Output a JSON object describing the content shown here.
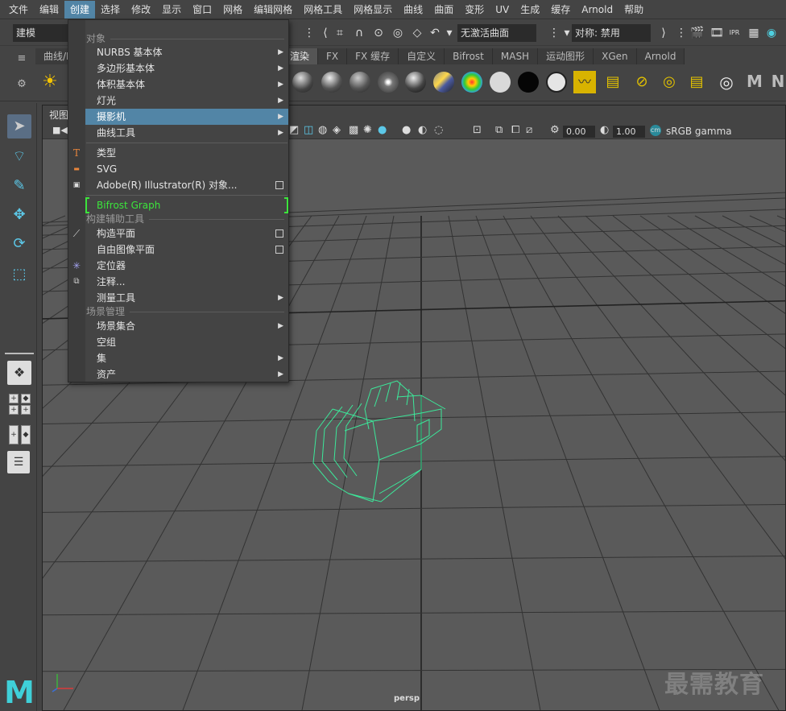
{
  "menubar": [
    "文件",
    "编辑",
    "创建",
    "选择",
    "修改",
    "显示",
    "窗口",
    "网格",
    "编辑网格",
    "网格工具",
    "网格显示",
    "曲线",
    "曲面",
    "变形",
    "UV",
    "生成",
    "缓存",
    "Arnold",
    "帮助"
  ],
  "statusline": {
    "mode": "建模",
    "live_surface": "无激活曲面",
    "symmetry": "对称: 禁用"
  },
  "shelf": {
    "tabs": [
      "曲线/曲面",
      "渲染",
      "FX",
      "FX 缓存",
      "自定义",
      "Bifrost",
      "MASH",
      "运动图形",
      "XGen",
      "Arnold"
    ],
    "active_tab": "渲染",
    "first_tab_visible": "曲线/I"
  },
  "panel": {
    "menu_first": "视图",
    "exposure": "0.00",
    "gamma": "1.00",
    "color_space": "sRGB gamma",
    "camera": "persp"
  },
  "dropdown": {
    "section_objects": "对象",
    "section_helpers": "构建辅助工具",
    "section_scene": "场景管理",
    "items": {
      "nurbs": "NURBS 基本体",
      "poly": "多边形基本体",
      "volume": "体积基本体",
      "lights": "灯光",
      "cameras": "摄影机",
      "curve_tools": "曲线工具",
      "type": "类型",
      "svg": "SVG",
      "illustrator": "Adobe(R) Illustrator(R) 对象...",
      "bifrost": "Bifrost Graph",
      "construction_plane": "构造平面",
      "free_image_plane": "自由图像平面",
      "locator": "定位器",
      "annotation": "注释...",
      "measure_tools": "测量工具",
      "scene_assembly": "场景集合",
      "empty_group": "空组",
      "sets": "集",
      "assets": "资产"
    }
  },
  "watermark": "最需教育",
  "colors": {
    "highlight": "#5285a6",
    "camera_wire": "#3ce89a",
    "bifrost_green": "#3ce43c"
  }
}
